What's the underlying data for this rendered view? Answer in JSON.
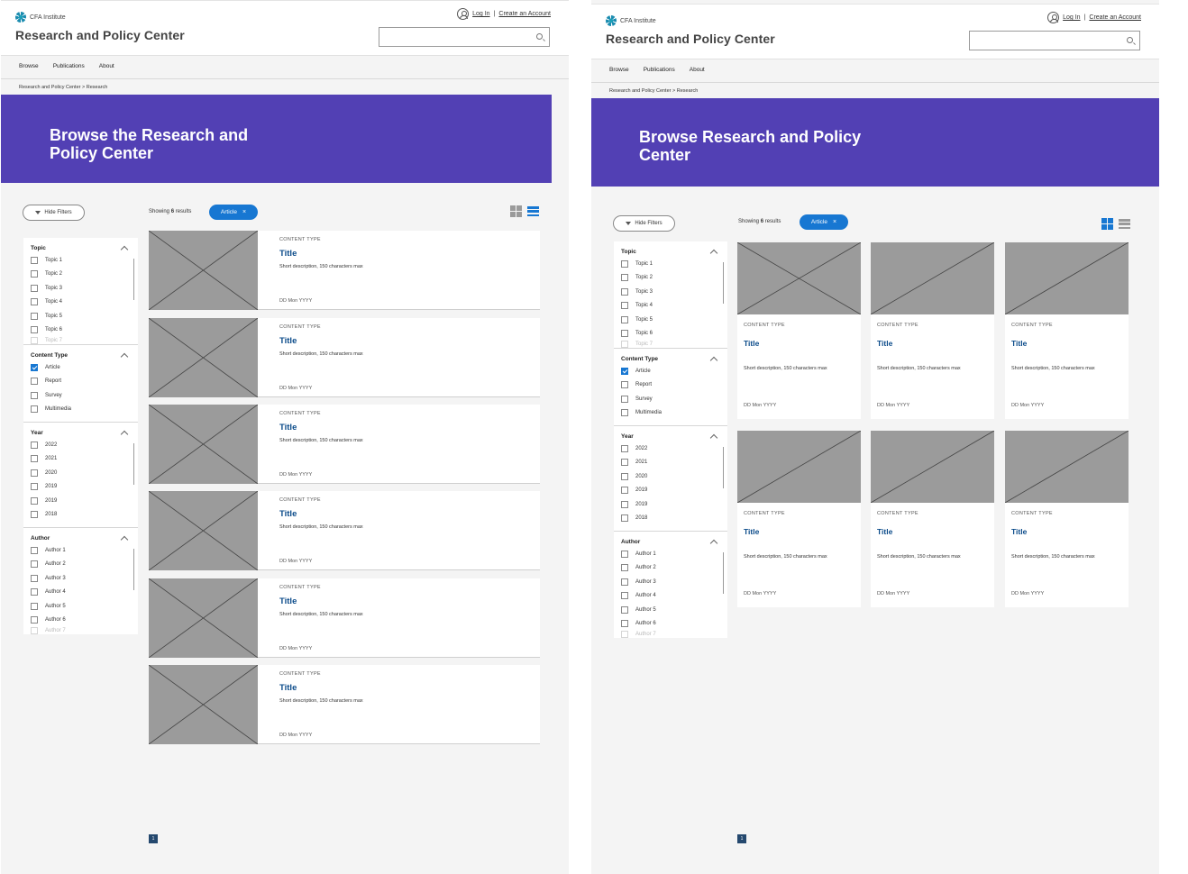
{
  "brand": {
    "logo_text": "CFA Institute",
    "site_title": "Research and Policy Center",
    "accent_color": "#5240b4",
    "link_color": "#1777d2"
  },
  "account": {
    "login": "Log In",
    "separator": "|",
    "create": "Create an Account"
  },
  "nav": {
    "items": [
      "Browse",
      "Publications",
      "About"
    ]
  },
  "breadcrumb": {
    "root": "Research and Policy Center",
    "sep": ">",
    "current": "Research"
  },
  "list_view": {
    "hero_title": "Browse the Research and Policy Center"
  },
  "grid_view": {
    "hero_title": "Browse Research and Policy Center"
  },
  "toolbar": {
    "hide_filters": "Hide Filters",
    "showing_prefix": "Showing",
    "count": "6",
    "results_suffix": "results",
    "active_filter": "Article",
    "chip_close": "×"
  },
  "filters": [
    {
      "title": "Topic",
      "options": [
        {
          "label": "Topic 1",
          "checked": false
        },
        {
          "label": "Topic 2",
          "checked": false
        },
        {
          "label": "Topic 3",
          "checked": false
        },
        {
          "label": "Topic 4",
          "checked": false
        },
        {
          "label": "Topic 5",
          "checked": false
        },
        {
          "label": "Topic 6",
          "checked": false
        }
      ],
      "more": "Topic 7"
    },
    {
      "title": "Content Type",
      "options": [
        {
          "label": "Article",
          "checked": true
        },
        {
          "label": "Report",
          "checked": false
        },
        {
          "label": "Survey",
          "checked": false
        },
        {
          "label": "Multimedia",
          "checked": false
        }
      ],
      "more": ""
    },
    {
      "title": "Year",
      "options": [
        {
          "label": "2022",
          "checked": false
        },
        {
          "label": "2021",
          "checked": false
        },
        {
          "label": "2020",
          "checked": false
        },
        {
          "label": "2019",
          "checked": false
        },
        {
          "label": "2019",
          "checked": false
        },
        {
          "label": "2018",
          "checked": false
        }
      ],
      "more": ""
    },
    {
      "title": "Author",
      "options": [
        {
          "label": "Author 1",
          "checked": false
        },
        {
          "label": "Author 2",
          "checked": false
        },
        {
          "label": "Author 3",
          "checked": false
        },
        {
          "label": "Author 4",
          "checked": false
        },
        {
          "label": "Author 5",
          "checked": false
        },
        {
          "label": "Author 6",
          "checked": false
        }
      ],
      "more": "Author 7"
    }
  ],
  "cards": [
    {
      "type": "CONTENT TYPE",
      "title": "Title",
      "desc": "Short description, 150 characters max",
      "date": "DD Mon YYYY"
    },
    {
      "type": "CONTENT TYPE",
      "title": "Title",
      "desc": "Short description, 150 characters max",
      "date": "DD Mon YYYY"
    },
    {
      "type": "CONTENT TYPE",
      "title": "Title",
      "desc": "Short description, 150 characters max",
      "date": "DD Mon YYYY"
    },
    {
      "type": "CONTENT TYPE",
      "title": "Title",
      "desc": "Short description, 150 characters max",
      "date": "DD Mon YYYY"
    },
    {
      "type": "CONTENT TYPE",
      "title": "Title",
      "desc": "Short description, 150 characters max",
      "date": "DD Mon YYYY"
    },
    {
      "type": "CONTENT TYPE",
      "title": "Title",
      "desc": "Short description, 150 characters max",
      "date": "DD Mon YYYY"
    }
  ],
  "pagination": {
    "current": "1"
  },
  "icons": {
    "search": "search-icon",
    "user": "user-icon",
    "filter": "funnel-icon",
    "grid": "grid-view-icon",
    "list": "list-view-icon",
    "collapse": "chevron-up-icon"
  }
}
